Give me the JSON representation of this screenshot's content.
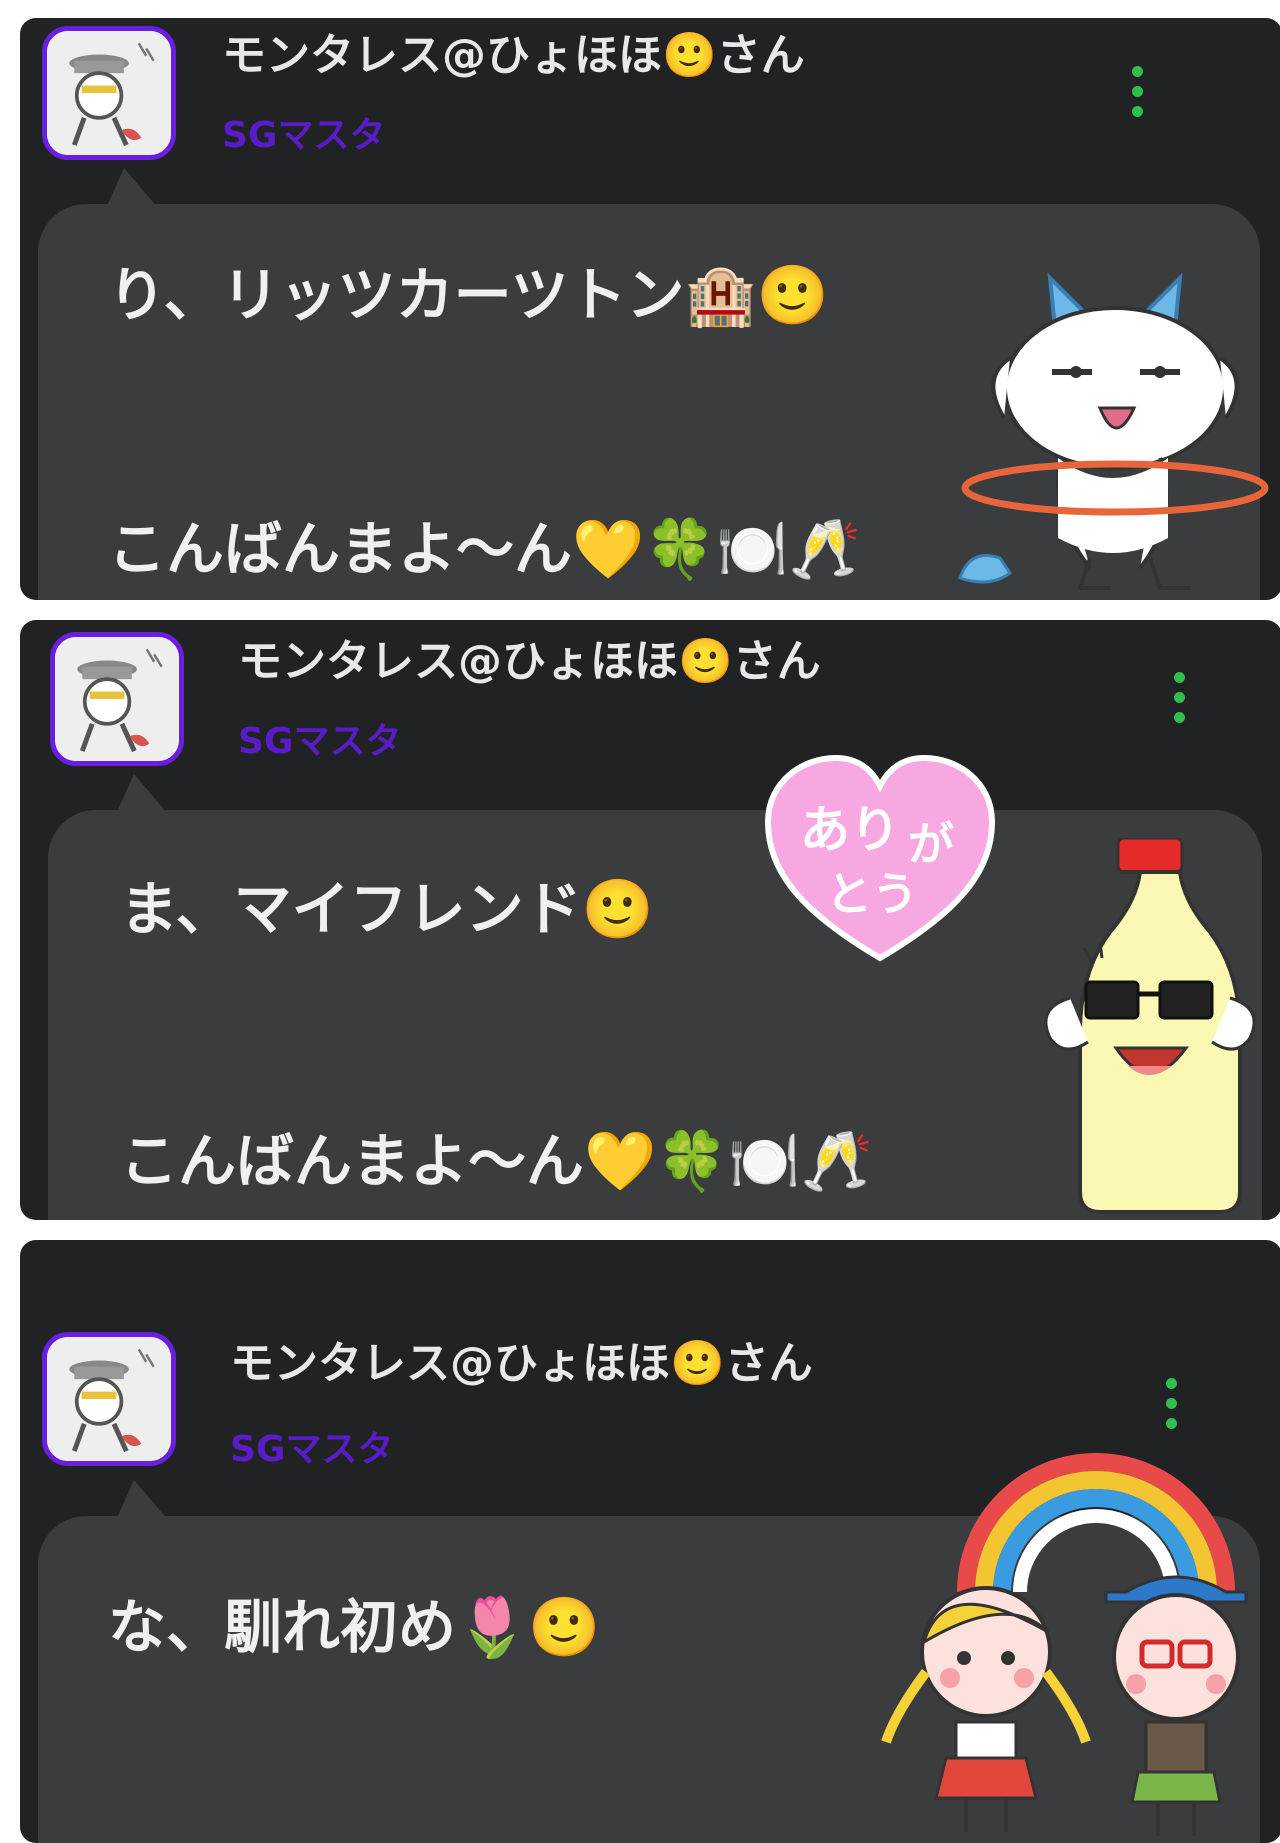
{
  "posts": [
    {
      "username": "モンタレス@ひょほほ🙂さん",
      "role": "SGマスタ",
      "line1": "り、リッツカーツトン🏨🙂",
      "line2": "こんばんまよ〜ん💛🍀🍽️🥂"
    },
    {
      "username": "モンタレス@ひょほほ🙂さん",
      "role": "SGマスタ",
      "line1": "ま、マイフレンド🙂",
      "line2": "こんばんまよ〜ん💛🍀🍽️🥂"
    },
    {
      "username": "モンタレス@ひょほほ🙂さん",
      "role": "SGマスタ",
      "line1": "な、馴れ初め🌷🙂"
    }
  ],
  "stickers": {
    "heart_text_1": "あり",
    "heart_text_2": "が",
    "heart_text_3": "とう"
  },
  "colors": {
    "card_bg": "#202224",
    "bubble_bg": "#3a3c3d",
    "role_purple": "#5a1cc8",
    "kebab_green": "#2fbf4a"
  }
}
